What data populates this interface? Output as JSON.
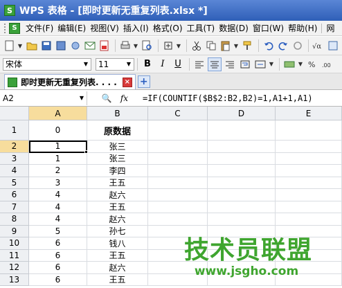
{
  "window": {
    "title": "WPS 表格 - [即时更新无重复列表.xlsx *]",
    "logo": "S"
  },
  "menubar": {
    "items": [
      "文件(F)",
      "编辑(E)",
      "视图(V)",
      "插入(I)",
      "格式(O)",
      "工具(T)",
      "数据(D)",
      "窗口(W)",
      "帮助(H)",
      "网"
    ]
  },
  "format_toolbar": {
    "font_name": "宋体",
    "font_size": "11",
    "bold": "B",
    "italic": "I",
    "underline": "U"
  },
  "document_tab": {
    "label": "即时更新无重复列表. . . .",
    "close": "×",
    "new": "+"
  },
  "formula_bar": {
    "cell_ref": "A2",
    "fx": "fx",
    "formula": "=IF(COUNTIF($B$2:B2,B2)=1,A1+1,A1)"
  },
  "sheet": {
    "columns": [
      "A",
      "B",
      "C",
      "D",
      "E"
    ],
    "selected_column": "A",
    "selected_row": "2",
    "rows": [
      {
        "n": "1",
        "a": "0",
        "b": "原数据"
      },
      {
        "n": "2",
        "a": "1",
        "b": "张三"
      },
      {
        "n": "3",
        "a": "1",
        "b": "张三"
      },
      {
        "n": "4",
        "a": "2",
        "b": "李四"
      },
      {
        "n": "5",
        "a": "3",
        "b": "王五"
      },
      {
        "n": "6",
        "a": "4",
        "b": "赵六"
      },
      {
        "n": "7",
        "a": "4",
        "b": "王五"
      },
      {
        "n": "8",
        "a": "4",
        "b": "赵六"
      },
      {
        "n": "9",
        "a": "5",
        "b": "孙七"
      },
      {
        "n": "10",
        "a": "6",
        "b": "钱八"
      },
      {
        "n": "11",
        "a": "6",
        "b": "王五"
      },
      {
        "n": "12",
        "a": "6",
        "b": "赵六"
      },
      {
        "n": "13",
        "a": "6",
        "b": "王五"
      }
    ]
  },
  "watermark": {
    "main": "技术员联盟",
    "url": "www.jsgho.com"
  },
  "colors": {
    "title_bar": "#2f5fb8",
    "selected_header": "#f7dd9d",
    "watermark": "#3fa52f"
  }
}
